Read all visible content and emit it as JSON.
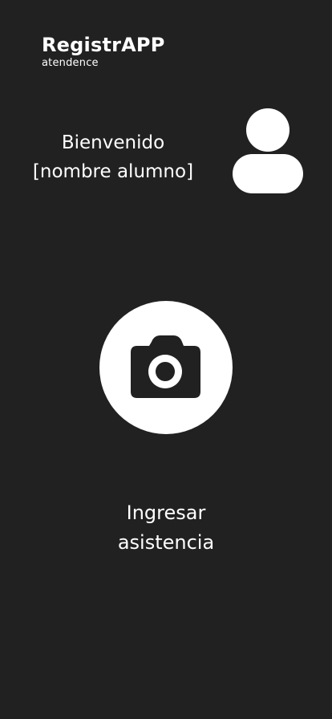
{
  "header": {
    "title": "RegistrAPP",
    "subtitle": "atendence"
  },
  "welcome": {
    "greeting": "Bienvenido",
    "student_name": "[nombre alumno]"
  },
  "icons": {
    "avatar": "user-icon",
    "camera": "camera-icon"
  },
  "action": {
    "line1": "Ingresar",
    "line2": "asistencia"
  },
  "colors": {
    "background": "#212121",
    "foreground": "#ffffff"
  }
}
